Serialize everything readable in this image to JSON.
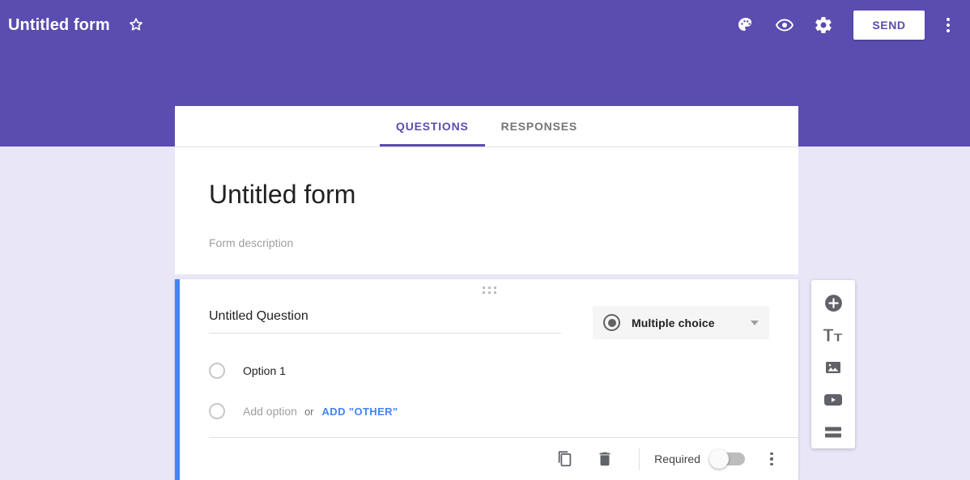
{
  "header": {
    "form_title": "Untitled form",
    "star_icon": "star-outline-icon",
    "actions": [
      {
        "name": "theme-button",
        "icon": "palette-icon"
      },
      {
        "name": "preview-button",
        "icon": "eye-icon"
      },
      {
        "name": "settings-button",
        "icon": "gear-icon"
      }
    ],
    "send_label": "SEND",
    "overflow_icon": "more-vert-icon",
    "background_color": "#5b4cb0"
  },
  "tabs": [
    {
      "label": "QUESTIONS",
      "active": true
    },
    {
      "label": "RESPONSES",
      "active": false
    }
  ],
  "form": {
    "title": "Untitled form",
    "description_placeholder": "Form description"
  },
  "question": {
    "drag_handle_icon": "drag-handle-icon",
    "title": "Untitled Question",
    "type": {
      "icon": "radio-filled-icon",
      "label": "Multiple choice",
      "chevron_icon": "chevron-down-icon"
    },
    "options": [
      {
        "name": "option-1",
        "label": "Option 1",
        "radio_icon": "radio-empty-icon"
      }
    ],
    "add_option": {
      "radio_icon": "radio-empty-icon",
      "placeholder": "Add option",
      "or_label": "or",
      "add_other_label": "ADD \"OTHER\"",
      "link_color": "#4285f4"
    },
    "footer": {
      "duplicate_icon": "duplicate-icon",
      "delete_icon": "trash-icon",
      "required_label": "Required",
      "required_on": false,
      "more_icon": "more-vert-icon"
    },
    "accent_color": "#4285f4"
  },
  "side_toolbar": [
    {
      "name": "add-question-button",
      "icon": "plus-circle-icon"
    },
    {
      "name": "add-title-button",
      "icon": "title-tt-icon"
    },
    {
      "name": "add-image-button",
      "icon": "image-icon"
    },
    {
      "name": "add-video-button",
      "icon": "video-icon"
    },
    {
      "name": "add-section-button",
      "icon": "section-icon"
    }
  ],
  "colors": {
    "brand_purple": "#5b4cb0",
    "page_background": "#e9e6f7",
    "link_blue": "#4285f4"
  }
}
